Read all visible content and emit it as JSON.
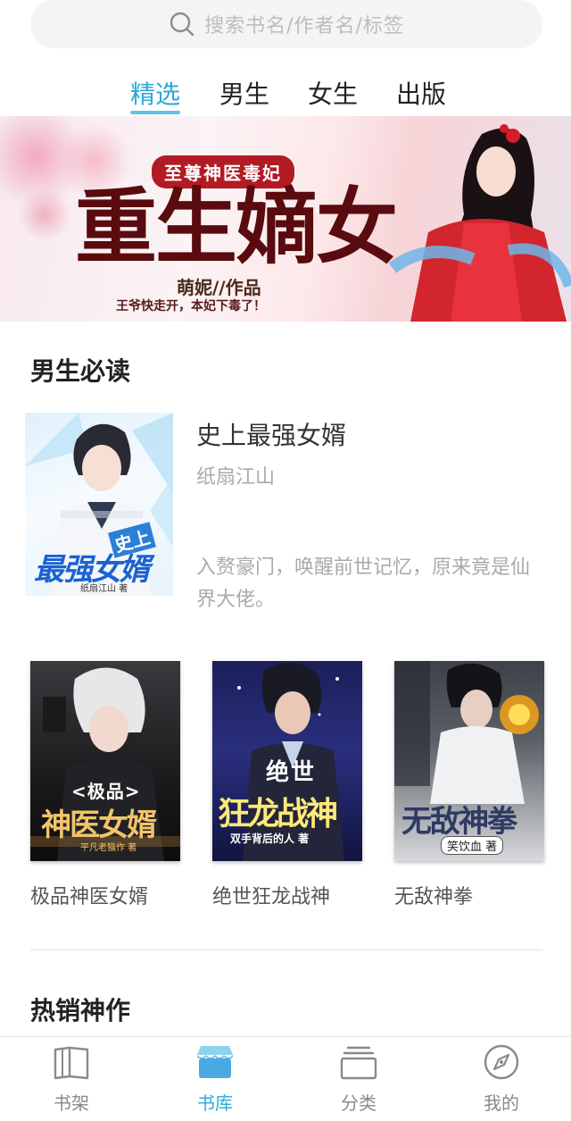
{
  "search": {
    "placeholder": "搜索书名/作者名/标签",
    "icon": "search-icon"
  },
  "tabs": [
    {
      "label": "精选",
      "active": true
    },
    {
      "label": "男生",
      "active": false
    },
    {
      "label": "女生",
      "active": false
    },
    {
      "label": "出版",
      "active": false
    }
  ],
  "banner": {
    "ribbon": "至尊神医毒妃",
    "title": "重生嫡女",
    "author": "萌妮//作品",
    "tagline": "王爷快走开，本妃下毒了！"
  },
  "male_section": {
    "title": "男生必读",
    "featured": {
      "title": "史上最强女婿",
      "author": "纸扇江山",
      "desc": "入赘豪门，唤醒前世记忆，原来竟是仙界大佬。",
      "cover_text": "最强女婿",
      "cover_text_small": "史上",
      "cover_author": "纸扇江山 著"
    },
    "books": [
      {
        "name": "极品神医女婿",
        "cover_text_top": "<极品>",
        "cover_text": "神医女婿",
        "cover_author": "平凡老猫作 著"
      },
      {
        "name": "绝世狂龙战神",
        "cover_text_top": "绝世",
        "cover_text": "狂龙战神",
        "cover_author": "双手背后的人 著"
      },
      {
        "name": "无敌神拳",
        "cover_text": "无敌神拳",
        "cover_author": "笑饮血 著"
      }
    ]
  },
  "hot_section": {
    "title": "热销神作"
  },
  "bottom_nav": [
    {
      "label": "书架",
      "icon": "book-open-icon",
      "active": false
    },
    {
      "label": "书库",
      "icon": "store-icon",
      "active": true
    },
    {
      "label": "分类",
      "icon": "folder-stack-icon",
      "active": false
    },
    {
      "label": "我的",
      "icon": "compass-icon",
      "active": false
    }
  ],
  "colors": {
    "accent": "#2aa9d8",
    "ribbon": "#b21b24"
  }
}
